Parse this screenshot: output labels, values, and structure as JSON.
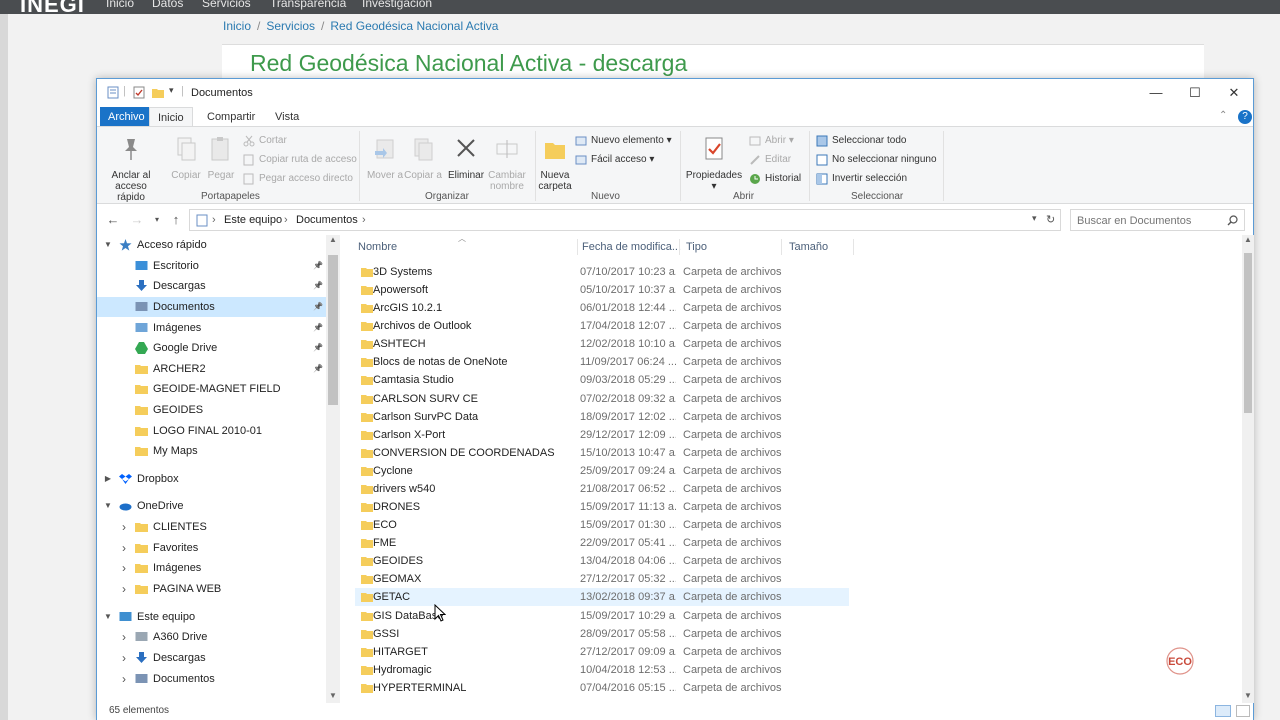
{
  "website": {
    "logo": "INEGI",
    "nav": [
      "Inicio",
      "Datos",
      "Servicios",
      "Transparencia",
      "Investigación"
    ],
    "breadcrumb": [
      "Inicio",
      "Servicios",
      "Red Geodésica Nacional Activa"
    ],
    "heading": "Red Geodésica Nacional Activa - descarga"
  },
  "window": {
    "title": "Documentos",
    "controls": {
      "minimize": "—",
      "maximize": "☐",
      "close": "✕"
    }
  },
  "ribbon": {
    "tabs": [
      "Archivo",
      "Inicio",
      "Compartir",
      "Vista"
    ],
    "portapapeles": {
      "label": "Portapapeles",
      "anclar": "Anclar al acceso rápido",
      "copiar": "Copiar",
      "pegar": "Pegar",
      "cortar": "Cortar",
      "copiar_ruta": "Copiar ruta de acceso",
      "pegar_acceso": "Pegar acceso directo"
    },
    "organizar": {
      "label": "Organizar",
      "mover": "Mover a",
      "copiar_a": "Copiar a",
      "eliminar": "Eliminar",
      "cambiar_nombre": "Cambiar nombre"
    },
    "nuevo": {
      "label": "Nuevo",
      "nueva_carpeta": "Nueva carpeta",
      "nuevo_elemento": "Nuevo elemento",
      "facil_acceso": "Fácil acceso"
    },
    "abrir": {
      "label": "Abrir",
      "propiedades": "Propiedades",
      "abrir": "Abrir",
      "editar": "Editar",
      "historial": "Historial"
    },
    "seleccionar": {
      "label": "Seleccionar",
      "todo": "Seleccionar todo",
      "ninguno": "No seleccionar ninguno",
      "invertir": "Invertir selección"
    }
  },
  "address": {
    "path": [
      "Este equipo",
      "Documentos"
    ],
    "search_placeholder": "Buscar en Documentos"
  },
  "navpane": {
    "items": [
      {
        "label": "Acceso rápido",
        "level": 0,
        "expanded": true,
        "icon": "star-icon",
        "pinned": false
      },
      {
        "label": "Escritorio",
        "level": 1,
        "icon": "desktop-icon",
        "pinned": true
      },
      {
        "label": "Descargas",
        "level": 1,
        "icon": "download-icon",
        "pinned": true
      },
      {
        "label": "Documentos",
        "level": 1,
        "icon": "documents-icon",
        "pinned": true,
        "selected": true
      },
      {
        "label": "Imágenes",
        "level": 1,
        "icon": "pictures-icon",
        "pinned": true
      },
      {
        "label": "Google Drive",
        "level": 1,
        "icon": "google-drive-icon",
        "pinned": true
      },
      {
        "label": "ARCHER2",
        "level": 1,
        "icon": "folder-icon",
        "pinned": true
      },
      {
        "label": "GEOIDE-MAGNET FIELD",
        "level": 1,
        "icon": "folder-icon"
      },
      {
        "label": "GEOIDES",
        "level": 1,
        "icon": "folder-icon"
      },
      {
        "label": "LOGO FINAL 2010-01",
        "level": 1,
        "icon": "folder-icon"
      },
      {
        "label": "My Maps",
        "level": 1,
        "icon": "folder-icon"
      },
      {
        "label": "Dropbox",
        "level": 0,
        "expanded": false,
        "icon": "dropbox-icon"
      },
      {
        "label": "OneDrive",
        "level": 0,
        "expanded": true,
        "icon": "onedrive-icon"
      },
      {
        "label": "CLIENTES",
        "level": 1,
        "icon": "folder-icon",
        "expandable": true
      },
      {
        "label": "Favorites",
        "level": 1,
        "icon": "folder-icon",
        "expandable": true
      },
      {
        "label": "Imágenes",
        "level": 1,
        "icon": "folder-icon",
        "expandable": true
      },
      {
        "label": "PAGINA WEB",
        "level": 1,
        "icon": "folder-icon",
        "expandable": true
      },
      {
        "label": "Este equipo",
        "level": 0,
        "expanded": true,
        "icon": "computer-icon"
      },
      {
        "label": "A360 Drive",
        "level": 1,
        "icon": "a360-icon",
        "expandable": true
      },
      {
        "label": "Descargas",
        "level": 1,
        "icon": "download-icon",
        "expandable": true
      },
      {
        "label": "Documentos",
        "level": 1,
        "icon": "documents-icon",
        "expandable": true
      }
    ]
  },
  "filelist": {
    "columns": [
      "Nombre",
      "Fecha de modifica...",
      "Tipo",
      "Tamaño"
    ],
    "rows": [
      {
        "name": "3D Systems",
        "date": "07/10/2017 10:23 a...",
        "type": "Carpeta de archivos"
      },
      {
        "name": "Apowersoft",
        "date": "05/10/2017 10:37 a...",
        "type": "Carpeta de archivos"
      },
      {
        "name": "ArcGIS 10.2.1",
        "date": "06/01/2018 12:44 ...",
        "type": "Carpeta de archivos"
      },
      {
        "name": "Archivos de Outlook",
        "date": "17/04/2018 12:07 ...",
        "type": "Carpeta de archivos"
      },
      {
        "name": "ASHTECH",
        "date": "12/02/2018 10:10 a...",
        "type": "Carpeta de archivos"
      },
      {
        "name": "Blocs de notas de OneNote",
        "date": "11/09/2017 06:24 ...",
        "type": "Carpeta de archivos"
      },
      {
        "name": "Camtasia Studio",
        "date": "09/03/2018 05:29 ...",
        "type": "Carpeta de archivos"
      },
      {
        "name": "CARLSON SURV CE",
        "date": "07/02/2018 09:32 a...",
        "type": "Carpeta de archivos"
      },
      {
        "name": "Carlson SurvPC Data",
        "date": "18/09/2017 12:02 ...",
        "type": "Carpeta de archivos"
      },
      {
        "name": "Carlson X-Port",
        "date": "29/12/2017 12:09 ...",
        "type": "Carpeta de archivos"
      },
      {
        "name": "CONVERSION DE COORDENADAS",
        "date": "15/10/2013 10:47 a...",
        "type": "Carpeta de archivos"
      },
      {
        "name": "Cyclone",
        "date": "25/09/2017 09:24 a...",
        "type": "Carpeta de archivos"
      },
      {
        "name": "drivers w540",
        "date": "21/08/2017 06:52 ...",
        "type": "Carpeta de archivos"
      },
      {
        "name": "DRONES",
        "date": "15/09/2017 11:13 a...",
        "type": "Carpeta de archivos"
      },
      {
        "name": "ECO",
        "date": "15/09/2017 01:30 ...",
        "type": "Carpeta de archivos"
      },
      {
        "name": "FME",
        "date": "22/09/2017 05:41 ...",
        "type": "Carpeta de archivos"
      },
      {
        "name": "GEOIDES",
        "date": "13/04/2018 04:06 ...",
        "type": "Carpeta de archivos"
      },
      {
        "name": "GEOMAX",
        "date": "27/12/2017 05:32 ...",
        "type": "Carpeta de archivos"
      },
      {
        "name": "GETAC",
        "date": "13/02/2018 09:37 a...",
        "type": "Carpeta de archivos",
        "hover": true
      },
      {
        "name": "GIS DataBase",
        "date": "15/09/2017 10:29 a...",
        "type": "Carpeta de archivos"
      },
      {
        "name": "GSSI",
        "date": "28/09/2017 05:58 ...",
        "type": "Carpeta de archivos"
      },
      {
        "name": "HITARGET",
        "date": "27/12/2017 09:09 a...",
        "type": "Carpeta de archivos"
      },
      {
        "name": "Hydromagic",
        "date": "10/04/2018 12:53 ...",
        "type": "Carpeta de archivos"
      },
      {
        "name": "HYPERTERMINAL",
        "date": "07/04/2016 05:15 ...",
        "type": "Carpeta de archivos"
      }
    ]
  },
  "status": {
    "count": "65 elementos"
  },
  "watermark": {
    "text": "ECO"
  },
  "colors": {
    "accent": "#1a73c8",
    "selection": "#cce8ff",
    "hover": "#e5f3ff",
    "folder": "#f5cd5b",
    "heading_green": "#3e9a4c"
  }
}
